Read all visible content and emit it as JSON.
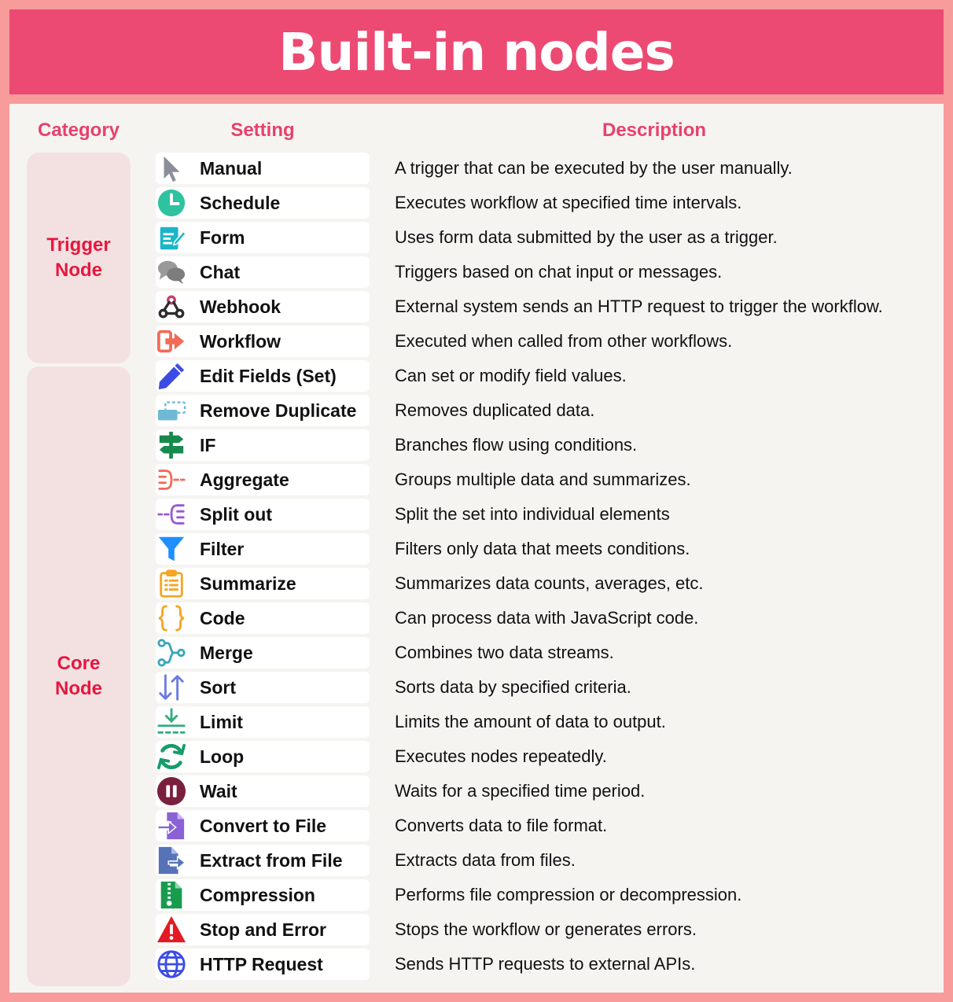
{
  "title": "Built-in nodes",
  "headers": {
    "category": "Category",
    "setting": "Setting",
    "description": "Description"
  },
  "categories": {
    "trigger": "Trigger Node",
    "core": "Core Node"
  },
  "colors": {
    "title_bg": "#ec4a72",
    "frame": "#f89b9b",
    "panel": "#f5f4f1",
    "header_text": "#e8416a",
    "category_text": "#e8163e",
    "category_bg": "#f3e1e2"
  },
  "nodes": [
    {
      "label": "Manual",
      "icon": "cursor-icon",
      "description": "A trigger that can be executed by the user manually."
    },
    {
      "label": "Schedule",
      "icon": "clock-icon",
      "description": "Executes workflow at specified time intervals."
    },
    {
      "label": "Form",
      "icon": "form-icon",
      "description": "Uses form data submitted by the user as a trigger."
    },
    {
      "label": "Chat",
      "icon": "chat-icon",
      "description": "Triggers based on chat input or messages."
    },
    {
      "label": "Webhook",
      "icon": "webhook-icon",
      "description": "External system sends an HTTP request to trigger the workflow."
    },
    {
      "label": "Workflow",
      "icon": "sign-in-icon",
      "description": "Executed when called from other workflows."
    },
    {
      "label": "Edit Fields (Set)",
      "icon": "pencil-icon",
      "description": "Can set or modify field values."
    },
    {
      "label": "Remove Duplicate",
      "icon": "duplicate-icon",
      "description": "Removes duplicated data."
    },
    {
      "label": "IF",
      "icon": "signpost-icon",
      "description": "Branches flow using conditions."
    },
    {
      "label": "Aggregate",
      "icon": "aggregate-icon",
      "description": "Groups multiple data and summarizes."
    },
    {
      "label": "Split out",
      "icon": "split-icon",
      "description": "Split the set into individual elements"
    },
    {
      "label": "Filter",
      "icon": "funnel-icon",
      "description": "Filters only data that meets conditions."
    },
    {
      "label": "Summarize",
      "icon": "clipboard-icon",
      "description": "Summarizes data counts, averages, etc."
    },
    {
      "label": "Code",
      "icon": "braces-icon",
      "description": "Can process data with JavaScript code."
    },
    {
      "label": "Merge",
      "icon": "merge-icon",
      "description": "Combines two data streams."
    },
    {
      "label": "Sort",
      "icon": "sort-icon",
      "description": "Sorts data by specified criteria."
    },
    {
      "label": "Limit",
      "icon": "limit-icon",
      "description": "Limits the amount of data to output."
    },
    {
      "label": "Loop",
      "icon": "sync-icon",
      "description": "Executes nodes repeatedly."
    },
    {
      "label": "Wait",
      "icon": "pause-icon",
      "description": "Waits for a specified time period."
    },
    {
      "label": "Convert to File",
      "icon": "file-import-icon",
      "description": "Converts data to file format."
    },
    {
      "label": "Extract from File",
      "icon": "file-export-icon",
      "description": "Extracts data from files."
    },
    {
      "label": "Compression",
      "icon": "zip-file-icon",
      "description": "Performs file compression or decompression."
    },
    {
      "label": "Stop and Error",
      "icon": "warning-icon",
      "description": "Stops the workflow or generates errors."
    },
    {
      "label": "HTTP Request",
      "icon": "globe-icon",
      "description": "Sends HTTP requests to external APIs."
    }
  ]
}
